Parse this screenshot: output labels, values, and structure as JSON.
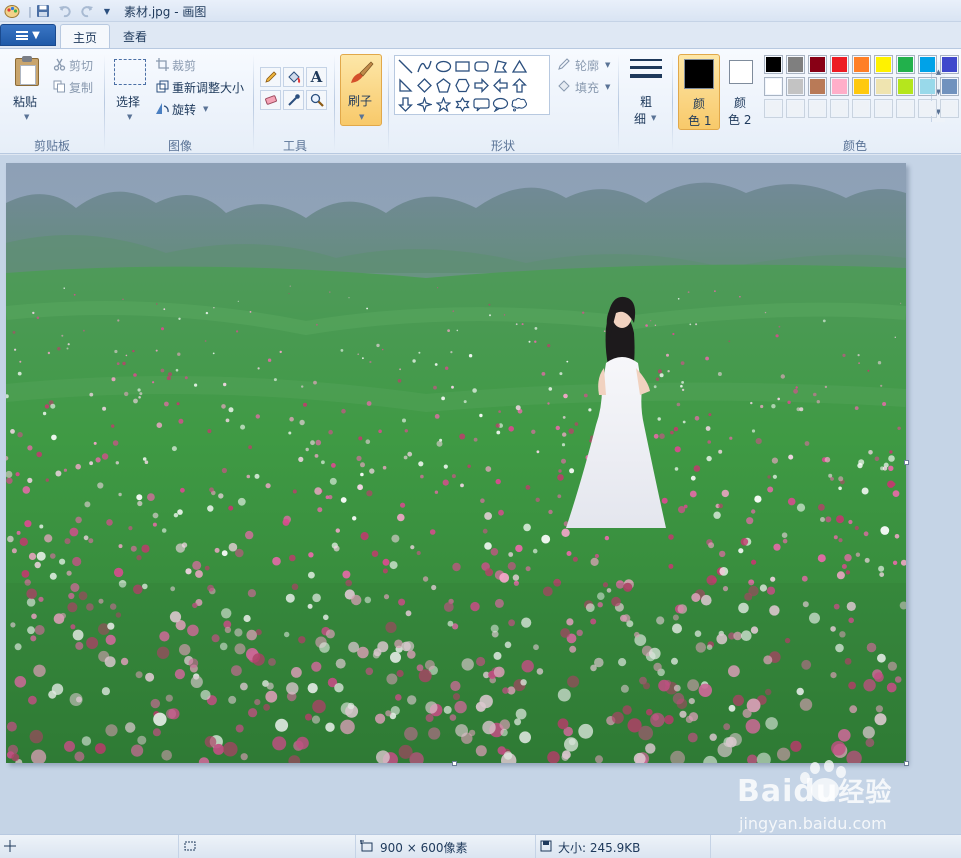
{
  "window": {
    "title": "素材.jpg - 画图"
  },
  "tabs": [
    {
      "label": "主页"
    },
    {
      "label": "查看"
    }
  ],
  "clipboard": {
    "paste": "粘贴",
    "cut": "剪切",
    "copy": "复制",
    "group": "剪贴板"
  },
  "image": {
    "select": "选择",
    "crop": "裁剪",
    "resize": "重新调整大小",
    "rotate": "旋转",
    "group": "图像"
  },
  "tools": {
    "group": "工具",
    "text_glyph": "A"
  },
  "brushes": {
    "label": "刷子"
  },
  "shapes": {
    "outline": "轮廓",
    "fill": "填充",
    "group": "形状",
    "items": [
      "line-icon",
      "curve-icon",
      "oval-icon",
      "rectangle-icon",
      "rounded-rectangle-icon",
      "polygon-icon",
      "triangle-icon",
      "right-triangle-icon",
      "diamond-icon",
      "pentagon-icon",
      "hexagon-icon",
      "right-arrow-icon",
      "left-arrow-icon",
      "up-arrow-icon",
      "down-arrow-icon",
      "four-point-star-icon",
      "five-point-star-icon",
      "six-point-star-icon",
      "rounded-callout-icon",
      "oval-callout-icon",
      "cloud-callout-icon"
    ]
  },
  "size": {
    "line1": "粗",
    "line2": "细"
  },
  "colors": {
    "color1_line1": "颜",
    "color1_line2": "色 1",
    "color2_line1": "颜",
    "color2_line2": "色 2",
    "group": "颜色",
    "color1": "#000000",
    "color2": "#ffffff",
    "palette": [
      "#000000",
      "#7f7f7f",
      "#880015",
      "#ed1c24",
      "#ff7f27",
      "#fff200",
      "#22b14c",
      "#00a2e8",
      "#3f48cc",
      "#ffffff",
      "#c3c3c3",
      "#b97a57",
      "#ffaec9",
      "#ffc90e",
      "#efe4b0",
      "#b5e61d",
      "#99d9ea",
      "#7092be"
    ]
  },
  "status": {
    "dimensions": "900 × 600像素",
    "size": "大小: 245.9KB"
  },
  "watermark": {
    "brand": "Baidu",
    "brand_cn": "经验",
    "url": "jingyan.baidu.com"
  }
}
